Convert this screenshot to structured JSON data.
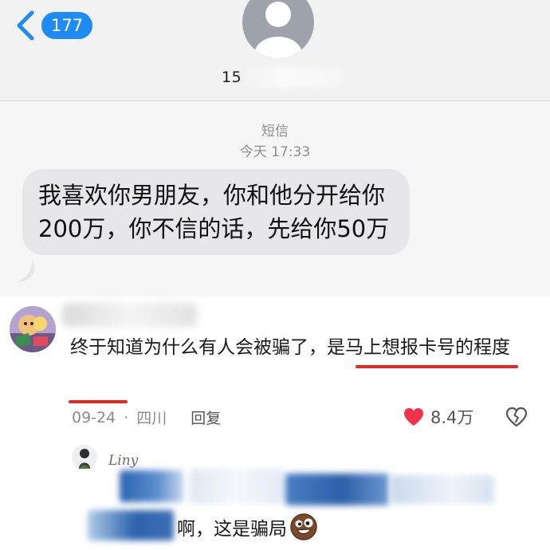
{
  "sms": {
    "back_badge": "177",
    "phone_number_visible": "15",
    "source_label": "短信",
    "timestamp": "今天 17:33",
    "message": "我喜欢你男朋友，你和他分开给你 200万，你不信的话，先给你50万"
  },
  "comment": {
    "text_before": "终于知道为什么有人会被骗了，",
    "text_highlighted": "是马上想报卡号的程度",
    "date": "09-24",
    "separator": "·",
    "location": "四川",
    "reply_label": "回复",
    "like_count": "8.4万"
  },
  "reply": {
    "username": "Liny",
    "text": "啊，这是骗局"
  },
  "colors": {
    "accent_blue": "#1f8bf5",
    "highlight_red": "#e02b1f",
    "heart_red": "#f2324a",
    "bubble_gray": "#e7e7ea"
  },
  "icons": [
    "back-chevron-icon",
    "contact-avatar-icon",
    "heart-icon",
    "dislike-broken-heart-icon",
    "emoji-icon"
  ]
}
